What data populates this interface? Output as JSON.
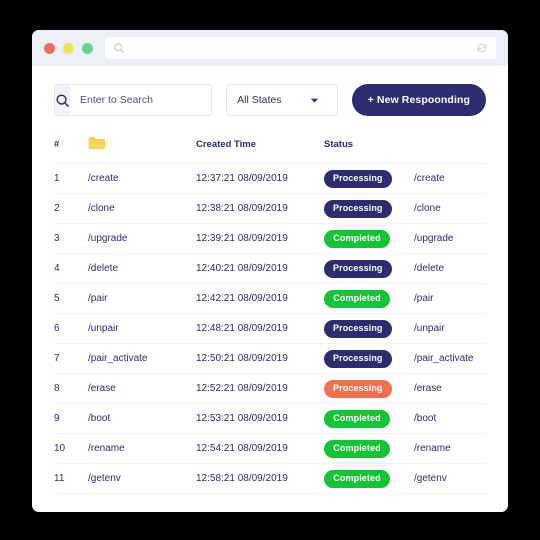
{
  "window": {
    "traffic_lights": [
      {
        "name": "close",
        "color": "#ec6a5e"
      },
      {
        "name": "minimize",
        "color": "#efe45c"
      },
      {
        "name": "maximize",
        "color": "#62d68a"
      }
    ],
    "address_bar": {
      "value": "",
      "placeholder": "",
      "search_icon": "search-icon",
      "refresh_icon": "refresh-icon"
    }
  },
  "toolbar": {
    "search": {
      "icon": "search-icon",
      "value": "",
      "placeholder": "Enter to Search",
      "dropdown_icon": "chevron-down-icon"
    },
    "state_filter": {
      "selected": "All States",
      "dropdown_icon": "chevron-down-icon"
    },
    "new_button_label": "+ New Respoonding"
  },
  "table": {
    "columns": [
      {
        "key": "index",
        "label": "#"
      },
      {
        "key": "name",
        "label": "",
        "icon": "folder-icon"
      },
      {
        "key": "created_time",
        "label": "Created Time"
      },
      {
        "key": "status",
        "label": "Status"
      },
      {
        "key": "path",
        "label": ""
      }
    ],
    "rows": [
      {
        "index": "1",
        "name": "/create",
        "created_time": "12:37:21 08/09/2019",
        "status": "Processing",
        "status_kind": "processing",
        "path": "/create"
      },
      {
        "index": "2",
        "name": "/clone",
        "created_time": "12:38:21 08/09/2019",
        "status": "Processing",
        "status_kind": "processing",
        "path": "/clone"
      },
      {
        "index": "3",
        "name": "/upgrade",
        "created_time": "12:39:21 08/09/2019",
        "status": "Completed",
        "status_kind": "completed",
        "path": "/upgrade"
      },
      {
        "index": "4",
        "name": "/delete",
        "created_time": "12:40:21 08/09/2019",
        "status": "Processing",
        "status_kind": "processing",
        "path": "/delete"
      },
      {
        "index": "5",
        "name": "/pair",
        "created_time": "12:42:21 08/09/2019",
        "status": "Completed",
        "status_kind": "completed",
        "path": "/pair"
      },
      {
        "index": "6",
        "name": "/unpair",
        "created_time": "12:48:21 08/09/2019",
        "status": "Processing",
        "status_kind": "processing",
        "path": "/unpair"
      },
      {
        "index": "7",
        "name": "/pair_activate",
        "created_time": "12:50:21 08/09/2019",
        "status": "Processing",
        "status_kind": "processing",
        "path": "/pair_activate"
      },
      {
        "index": "8",
        "name": "/erase",
        "created_time": "12:52:21 08/09/2019",
        "status": "Processing",
        "status_kind": "alert",
        "path": "/erase"
      },
      {
        "index": "9",
        "name": "/boot",
        "created_time": "12:53:21 08/09/2019",
        "status": "Completed",
        "status_kind": "completed",
        "path": "/boot"
      },
      {
        "index": "10",
        "name": "/rename",
        "created_time": "12:54:21 08/09/2019",
        "status": "Completed",
        "status_kind": "completed",
        "path": "/rename"
      },
      {
        "index": "11",
        "name": "/getenv",
        "created_time": "12:58:21 08/09/2019",
        "status": "Completed",
        "status_kind": "completed",
        "path": "/getenv"
      }
    ]
  },
  "colors": {
    "brand_navy": "#2b2d6e",
    "status_completed": "#14c434",
    "status_alert": "#f07050",
    "folder_yellow": "#f2c94c",
    "page_background": "#000000",
    "titlebar": "#eceef8"
  }
}
